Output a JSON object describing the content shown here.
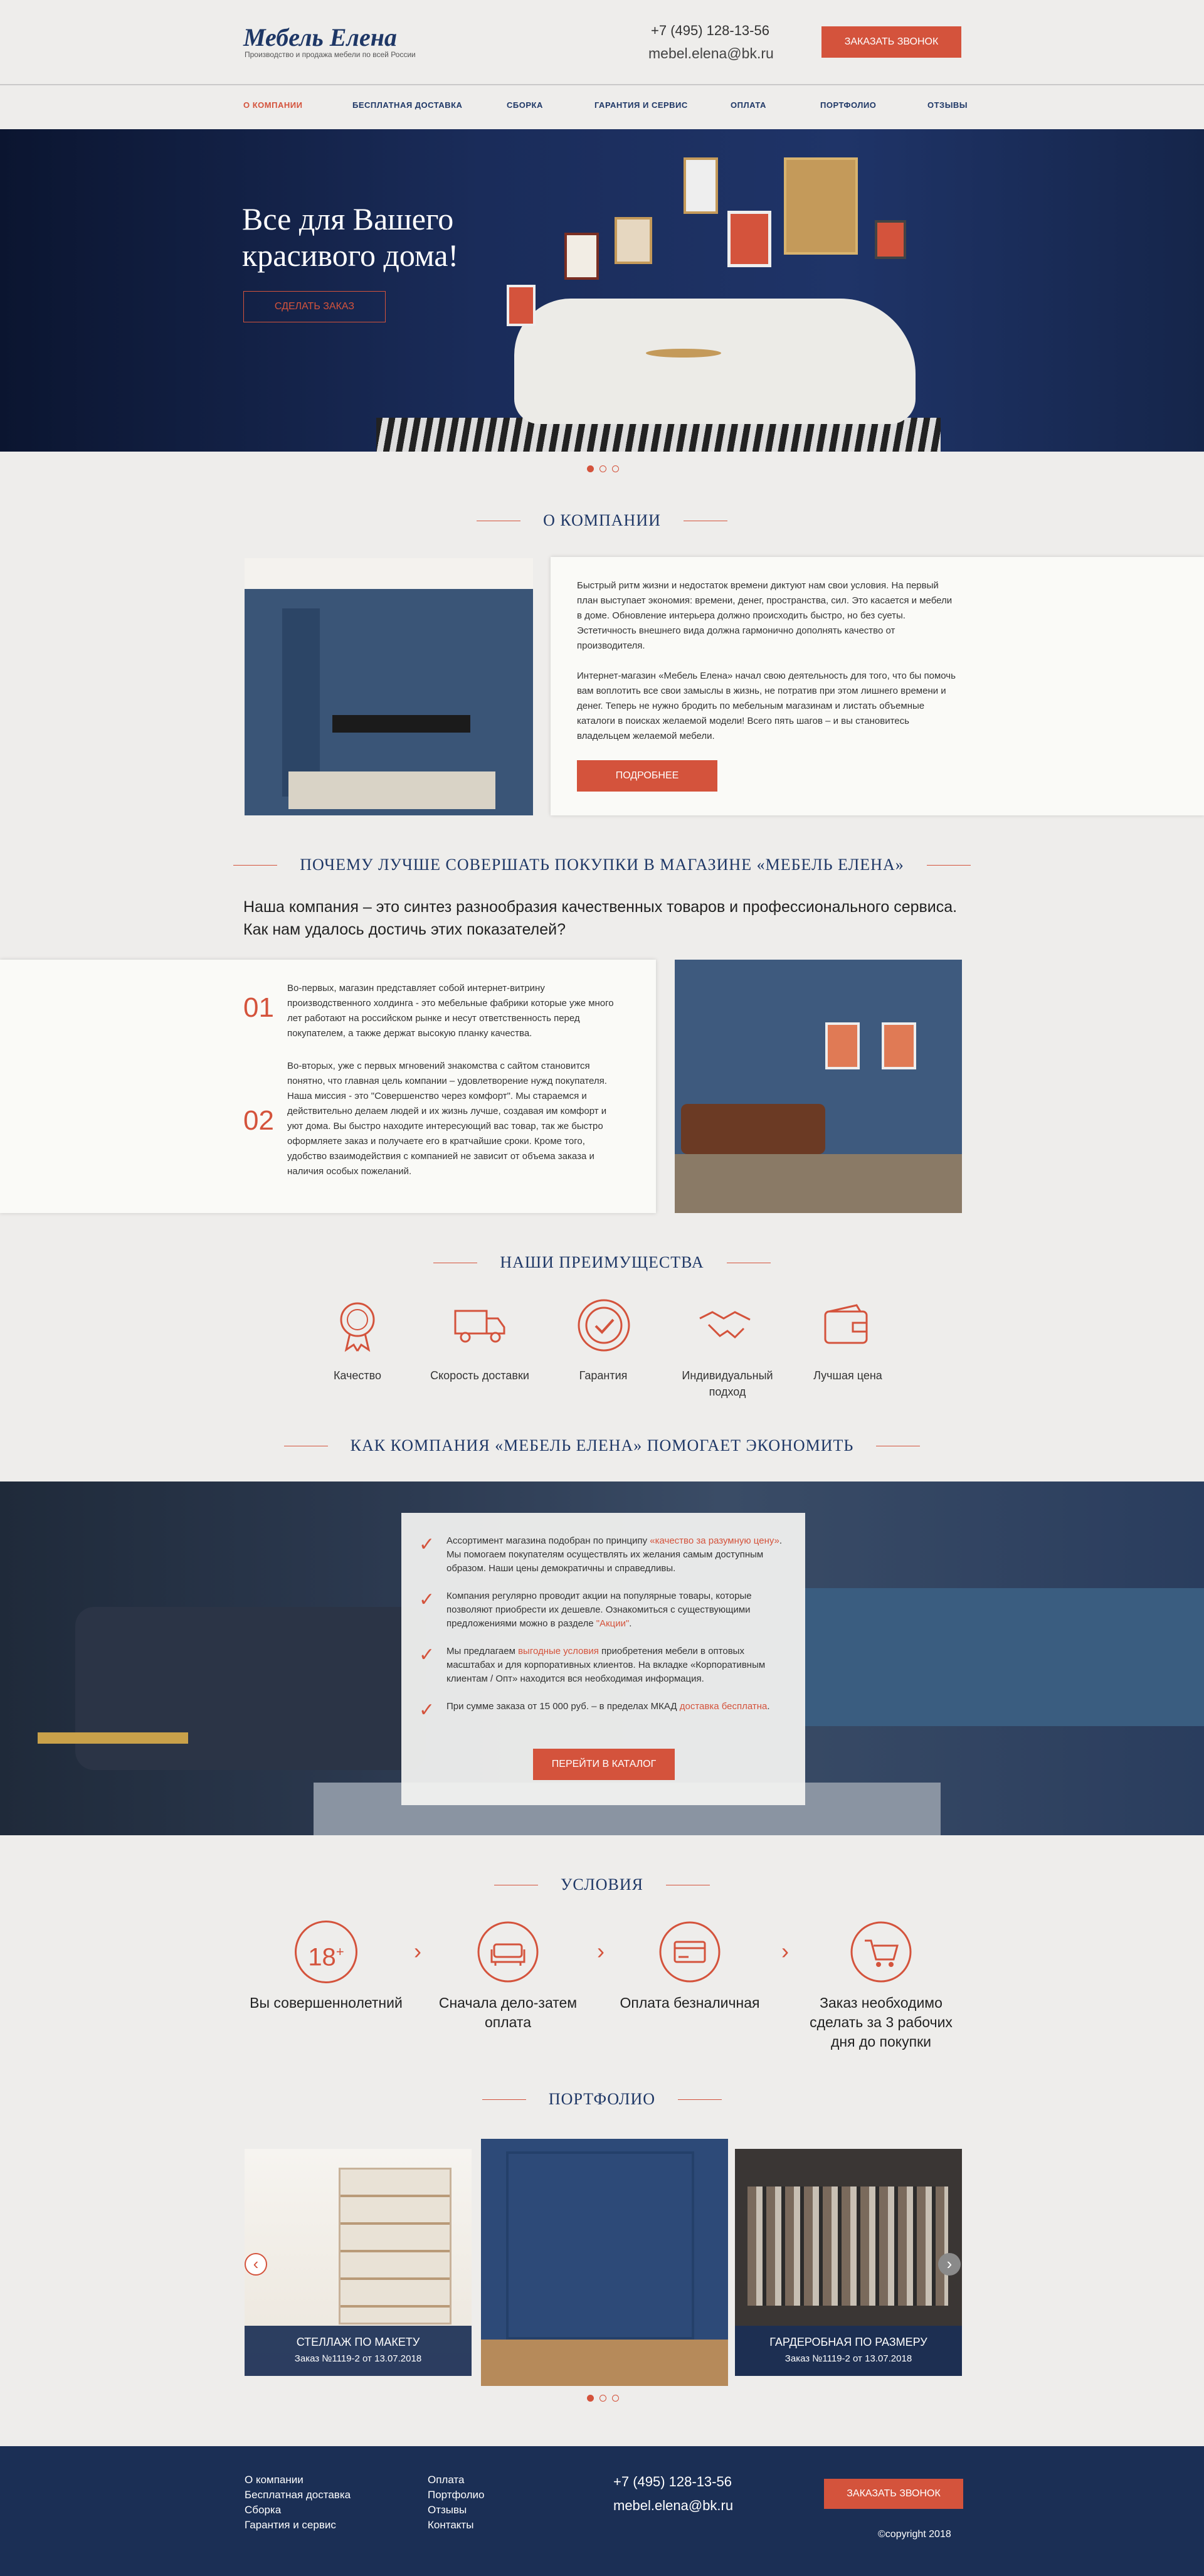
{
  "header": {
    "logo_title": "Мебель Елена",
    "logo_subtitle": "Производство и продажа мебели по всей России",
    "phone": "+7 (495) 128-13-56",
    "email": "mebel.elena@bk.ru",
    "call_button": "ЗАКАЗАТЬ ЗВОНОК"
  },
  "nav": [
    "О КОМПАНИИ",
    "БЕСПЛАТНАЯ ДОСТАВКА",
    "СБОРКА",
    "ГАРАНТИЯ И СЕРВИС",
    "ОПЛАТА",
    "ПОРТФОЛИО",
    "ОТЗЫВЫ"
  ],
  "hero": {
    "title_line1": "Все для Вашего",
    "title_line2": "красивого дома!",
    "button": "СДЕЛАТЬ ЗАКАЗ"
  },
  "about": {
    "title": "О КОМПАНИИ",
    "p1": "Быстрый ритм жизни и недостаток времени диктуют нам свои условия. На первый план выступает экономия: времени, денег, пространства, сил. Это касается и мебели в доме. Обновление интерьера должно происходить быстро, но без суеты. Эстетичность внешнего вида должна гармонично дополнять качество от производителя.",
    "p2": "Интернет-магазин «Мебель Елена» начал свою деятельность для того, что бы помочь вам воплотить все свои замыслы в жизнь, не потратив при этом лишнего времени и денег. Теперь не нужно бродить по мебельным магазинам и листать объемные каталоги в поисках желаемой модели! Всего пять шагов – и вы становитесь владельцем желаемой мебели.",
    "button": "ПОДРОБНЕЕ"
  },
  "why": {
    "title": "ПОЧЕМУ ЛУЧШЕ СОВЕРШАТЬ ПОКУПКИ В МАГАЗИНЕ «МЕБЕЛЬ ЕЛЕНА»",
    "intro": "Наша компания – это синтез разнообразия качественных товаров и профессионального сервиса. Как нам удалось достичь этих показателей?",
    "n1": "01",
    "t1": "Во-первых, магазин представляет собой интернет-витрину производственного холдинга - это мебельные фабрики которые уже много лет работают на российском рынке и несут ответственность перед покупателем, а также держат высокую планку качества.",
    "n2": "02",
    "t2": "Во-вторых, уже с первых мгновений знакомства с сайтом становится понятно, что главная цель компании – удовлетворение нужд покупателя. Наша миссия -  это \"Совершенство через комфорт\". Мы стараемся и действительно делаем людей и их жизнь лучше, создавая им комфорт и уют дома. Вы быстро находите интересующий вас товар, так же быстро оформляете заказ и получаете его в кратчайшие сроки. Кроме того, удобство взаимодействия с компанией не зависит от объема заказа и наличия особых пожеланий."
  },
  "advantages": {
    "title": "НАШИ ПРЕИМУЩЕСТВА",
    "items": [
      "Качество",
      "Скорость доставки",
      "Гарантия",
      "Индивидуальный подход",
      "Лучшая цена"
    ]
  },
  "economy": {
    "title": "КАК КОМПАНИЯ «МЕБЕЛЬ ЕЛЕНА» ПОМОГАЕТ ЭКОНОМИТЬ",
    "i1a": "Ассортимент магазина подобран по принципу ",
    "i1b": "«качество за разумную цену»",
    "i1c": ". Мы помогаем покупателям осуществлять их желания самым доступным образом. Наши цены демократичны и справедливы.",
    "i2": "Компания регулярно проводит акции на популярные товары, которые позволяют приобрести их дешевле. Ознакомиться с существующими предложениями можно в разделе ",
    "i2b": "\"Акции\"",
    "i2c": ".",
    "i3a": "Мы предлагаем ",
    "i3b": "выгодные условия",
    "i3c": " приобретения мебели в оптовых масштабах и для корпоративных клиентов. На вкладке «Корпоративным клиентам / Опт» находится вся необходимая информация.",
    "i4a": "При сумме заказа от 15 000 руб. – в пределах МКАД ",
    "i4b": "доставка бесплатна",
    "i4c": ".",
    "button": "ПЕРЕЙТИ В КАТАЛОГ"
  },
  "conditions": {
    "title": "УСЛОВИЯ",
    "age": "18",
    "items": [
      "Вы совершеннолетний",
      "Сначала дело-затем оплата",
      "Оплата безналичная",
      "Заказ необходимо сделать за 3 рабочих дня до покупки"
    ]
  },
  "portfolio": {
    "title": "ПОРТФОЛИО",
    "cards": [
      {
        "title": "СТЕЛЛАЖ ПО МАКЕТУ",
        "sub": "Заказ №1119-2 от 13.07.2018"
      },
      {
        "title": "",
        "sub": ""
      },
      {
        "title": "ГАРДЕРОБНАЯ ПО РАЗМЕРУ",
        "sub": "Заказ №1119-2 от 13.07.2018"
      }
    ]
  },
  "footer": {
    "col1": [
      "О компании",
      "Бесплатная доставка",
      "Сборка",
      "Гарантия и сервис"
    ],
    "col2": [
      "Оплата",
      "Портфолио",
      "Отзывы",
      "Контакты"
    ],
    "phone": "+7 (495) 128-13-56",
    "email": "mebel.elena@bk.ru",
    "button": "ЗАКАЗАТЬ ЗВОНОК",
    "copyright": "©copyright 2018"
  },
  "colors": {
    "accent": "#d4533c",
    "navy": "#1e3766",
    "footer_bg": "#1b2f55"
  }
}
